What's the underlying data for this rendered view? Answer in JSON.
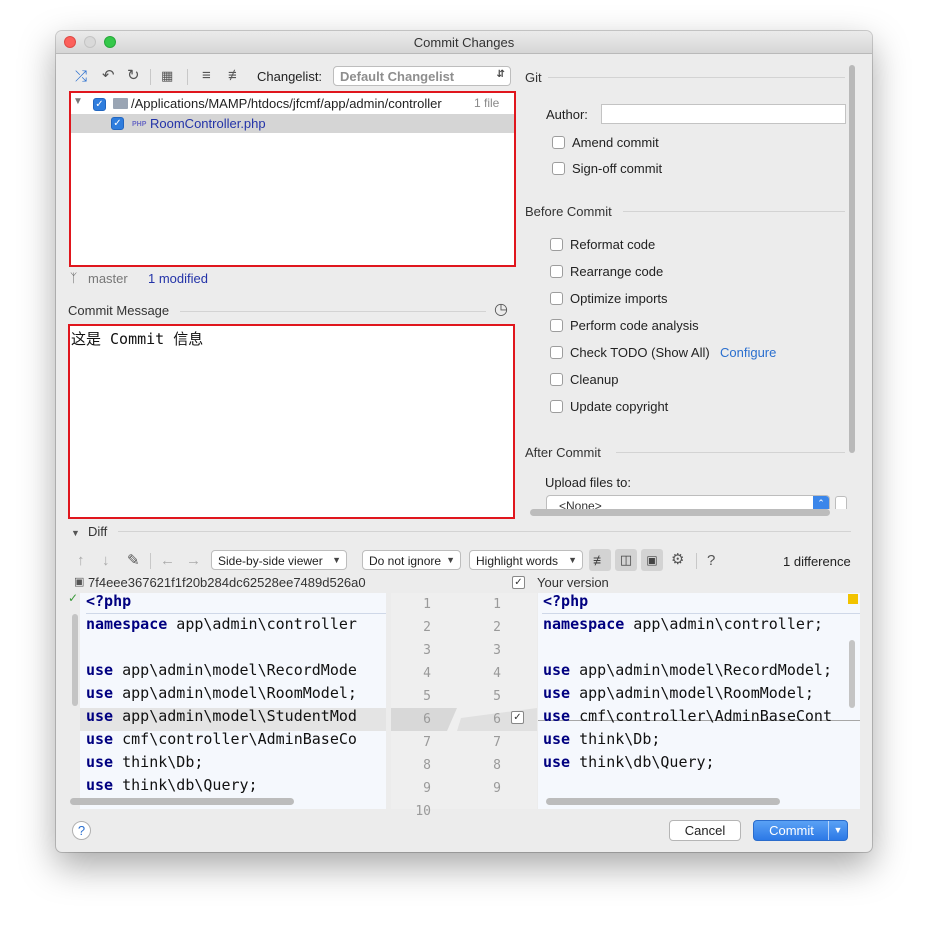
{
  "window": {
    "title": "Commit Changes"
  },
  "toolbar": {
    "changelist_label": "Changelist:",
    "changelist_value": "Default Changelist"
  },
  "tree": {
    "folder_path": "/Applications/MAMP/htdocs/jfcmf/app/admin/controller",
    "folder_count": "1 file",
    "file_badge": "PHP",
    "file_name": "RoomController.php"
  },
  "branch": {
    "name": "master",
    "modified": "1 modified"
  },
  "commit_message": {
    "label": "Commit Message",
    "text": "这是 Commit 信息"
  },
  "git": {
    "header": "Git",
    "author_label": "Author:",
    "author_value": "",
    "amend": "Amend commit",
    "signoff": "Sign-off commit"
  },
  "before_commit": {
    "header": "Before Commit",
    "reformat": "Reformat code",
    "rearrange": "Rearrange code",
    "optimize": "Optimize imports",
    "analysis": "Perform code analysis",
    "todo": "Check TODO (Show All)",
    "todo_link": "Configure",
    "cleanup": "Cleanup",
    "copyright": "Update copyright"
  },
  "after_commit": {
    "header": "After Commit",
    "upload_label": "Upload files to:",
    "upload_value": "<None>"
  },
  "diff": {
    "label": "Diff",
    "viewer": "Side-by-side viewer",
    "ignore": "Do not ignore",
    "highlight": "Highlight words",
    "help": "?",
    "count": "1 difference",
    "left_revision": "7f4eee367621f1f20b284dc62528ee7489d526a0",
    "right_revision": "Your version",
    "left_lines": [
      "<?php",
      "namespace app\\admin\\controller",
      "",
      "use app\\admin\\model\\RecordMode",
      "use app\\admin\\model\\RoomModel;",
      "use app\\admin\\model\\StudentMod",
      "use cmf\\controller\\AdminBaseCo",
      "use think\\Db;",
      "use think\\db\\Query;"
    ],
    "right_lines": [
      "<?php",
      "namespace app\\admin\\controller;",
      "",
      "use app\\admin\\model\\RecordModel;",
      "use app\\admin\\model\\RoomModel;",
      "use cmf\\controller\\AdminBaseCont",
      "use think\\Db;",
      "use think\\db\\Query;",
      ""
    ],
    "left_numbers": [
      "1",
      "2",
      "3",
      "4",
      "5",
      "6",
      "7",
      "8",
      "9",
      "10"
    ],
    "right_numbers": [
      "1",
      "2",
      "3",
      "4",
      "5",
      "6",
      "7",
      "8",
      "9"
    ]
  },
  "buttons": {
    "help": "?",
    "cancel": "Cancel",
    "commit": "Commit"
  },
  "colors": {
    "accent": "#2f7ddd",
    "highlight_border": "#e0161d",
    "link": "#2a6fcf",
    "keyword": "#000080"
  }
}
